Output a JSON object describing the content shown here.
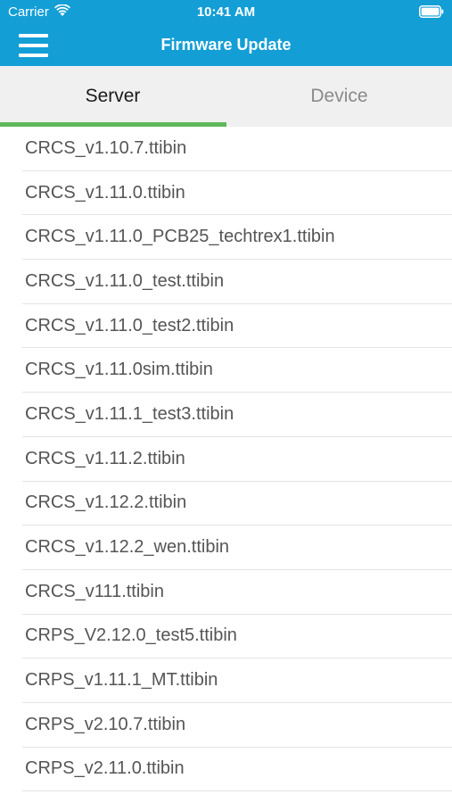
{
  "status_bar": {
    "carrier": "Carrier",
    "time": "10:41 AM",
    "wifi_icon": "wifi-icon",
    "battery_icon": "battery-icon"
  },
  "nav": {
    "title": "Firmware Update",
    "menu_icon": "hamburger-menu-icon"
  },
  "tabs": [
    {
      "label": "Server",
      "selected": true
    },
    {
      "label": "Device",
      "selected": false
    }
  ],
  "colors": {
    "header": "#139ed6",
    "tab_indicator": "#5fb85a",
    "tab_background": "#f0f0f0"
  },
  "files": [
    "CRCS_v1.10.7.ttibin",
    "CRCS_v1.11.0.ttibin",
    "CRCS_v1.11.0_PCB25_techtrex1.ttibin",
    "CRCS_v1.11.0_test.ttibin",
    "CRCS_v1.11.0_test2.ttibin",
    "CRCS_v1.11.0sim.ttibin",
    "CRCS_v1.11.1_test3.ttibin",
    "CRCS_v1.11.2.ttibin",
    "CRCS_v1.12.2.ttibin",
    "CRCS_v1.12.2_wen.ttibin",
    "CRCS_v111.ttibin",
    "CRPS_V2.12.0_test5.ttibin",
    "CRPS_v1.11.1_MT.ttibin",
    "CRPS_v2.10.7.ttibin",
    "CRPS_v2.11.0.ttibin"
  ]
}
